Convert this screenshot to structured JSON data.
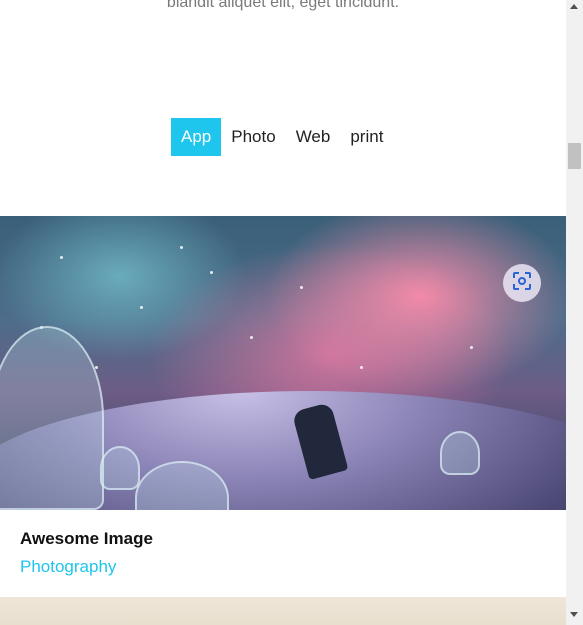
{
  "intro": {
    "text": "blandit aliquet elit, eget tincidunt."
  },
  "filters": {
    "items": [
      {
        "label": "App",
        "active": true
      },
      {
        "label": "Photo",
        "active": false
      },
      {
        "label": "Web",
        "active": false
      },
      {
        "label": "print",
        "active": false
      }
    ],
    "active_color": "#1ec5ec"
  },
  "portfolio_item": {
    "title": "Awesome Image",
    "category": "Photography",
    "overlay_icon": "lens-scan-icon"
  },
  "scrollbar": {
    "up_icon": "chevron-up-icon",
    "down_icon": "chevron-down-icon"
  }
}
